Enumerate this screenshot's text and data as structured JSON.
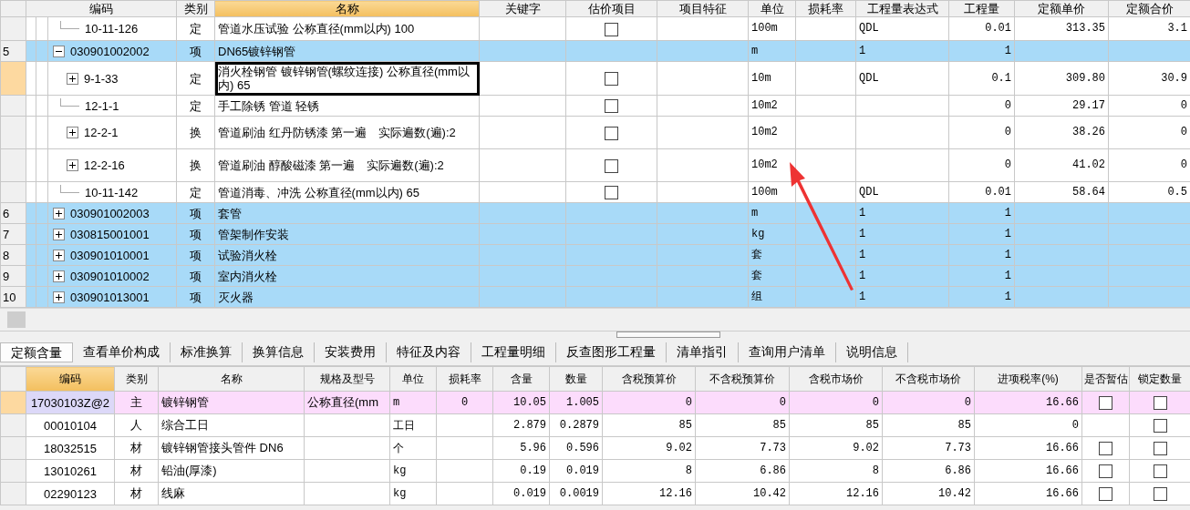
{
  "upper_table": {
    "columns": [
      {
        "label": "编码",
        "selected": false
      },
      {
        "label": "类别",
        "selected": false
      },
      {
        "label": "名称",
        "selected": true
      },
      {
        "label": "关键字",
        "selected": false
      },
      {
        "label": "估价项目",
        "selected": false
      },
      {
        "label": "项目特征",
        "selected": false
      },
      {
        "label": "单位",
        "selected": false
      },
      {
        "label": "损耗率",
        "selected": false
      },
      {
        "label": "工程量表达式",
        "selected": false
      },
      {
        "label": "工程量",
        "selected": false
      },
      {
        "label": "定额单价",
        "selected": false
      },
      {
        "label": "定额合价",
        "selected": false
      }
    ],
    "rows": [
      {
        "kind": "quota",
        "selected": false,
        "code": "10-11-126",
        "type": "定",
        "name": "管道水压试验 公称直径(mm以内) 100",
        "estimate": false,
        "unit": "100m",
        "expression": "QDL",
        "quantity": "0.01",
        "unit_price": "313.35",
        "total_price": "3.1"
      },
      {
        "kind": "item",
        "selected": false,
        "row_number": "5",
        "expanded": true,
        "code": "030901002002",
        "type": "项",
        "name": "DN65镀锌钢管",
        "unit": "m",
        "expression": "1",
        "quantity": "1",
        "children": [
          {
            "kind": "quota",
            "selected": true,
            "expanded": false,
            "code": "9-1-33",
            "type": "定",
            "name": "消火栓钢管 镀锌钢管(螺纹连接) 公称直径(mm以内) 65",
            "estimate": false,
            "unit": "10m",
            "expression": "QDL",
            "quantity": "0.1",
            "unit_price": "309.80",
            "total_price": "30.9"
          },
          {
            "kind": "quota",
            "selected": false,
            "code": "12-1-1",
            "type": "定",
            "name": "手工除锈 管道 轻锈",
            "estimate": false,
            "unit": "10m2",
            "quantity": "0",
            "unit_price": "29.17",
            "total_price": "0"
          },
          {
            "kind": "quota",
            "selected": false,
            "expanded": false,
            "code": "12-2-1",
            "type": "换",
            "name": "管道刷油 红丹防锈漆 第一遍　实际遍数(遍):2",
            "estimate": false,
            "unit": "10m2",
            "quantity": "0",
            "unit_price": "38.26",
            "total_price": "0"
          },
          {
            "kind": "quota",
            "selected": false,
            "expanded": false,
            "code": "12-2-16",
            "type": "换",
            "name": "管道刷油 醇酸磁漆 第一遍　实际遍数(遍):2",
            "estimate": false,
            "unit": "10m2",
            "quantity": "0",
            "unit_price": "41.02",
            "total_price": "0"
          },
          {
            "kind": "quota",
            "selected": false,
            "code": "10-11-142",
            "type": "定",
            "name": "管道消毒、冲洗 公称直径(mm以内) 65",
            "estimate": false,
            "unit": "100m",
            "expression": "QDL",
            "quantity": "0.01",
            "unit_price": "58.64",
            "total_price": "0.5"
          }
        ]
      },
      {
        "kind": "item",
        "selected": false,
        "row_number": "6",
        "expanded": false,
        "code": "030901002003",
        "type": "项",
        "name": "套管",
        "unit": "m",
        "expression": "1",
        "quantity": "1"
      },
      {
        "kind": "item",
        "selected": false,
        "row_number": "7",
        "expanded": false,
        "code": "030815001001",
        "type": "项",
        "name": "管架制作安装",
        "unit": "kg",
        "expression": "1",
        "quantity": "1"
      },
      {
        "kind": "item",
        "selected": false,
        "row_number": "8",
        "expanded": false,
        "code": "030901010001",
        "type": "项",
        "name": "试验消火栓",
        "unit": "套",
        "expression": "1",
        "quantity": "1"
      },
      {
        "kind": "item",
        "selected": false,
        "row_number": "9",
        "expanded": false,
        "code": "030901010002",
        "type": "项",
        "name": "室内消火栓",
        "unit": "套",
        "expression": "1",
        "quantity": "1"
      },
      {
        "kind": "item",
        "selected": false,
        "row_number": "10",
        "expanded": false,
        "code": "030901013001",
        "type": "项",
        "name": "灭火器",
        "unit": "组",
        "expression": "1",
        "quantity": "1"
      }
    ]
  },
  "tabs": [
    {
      "label": "定额含量",
      "selected": true
    },
    {
      "label": "查看单价构成",
      "selected": false
    },
    {
      "label": "标准换算",
      "selected": false
    },
    {
      "label": "换算信息",
      "selected": false
    },
    {
      "label": "安装费用",
      "selected": false
    },
    {
      "label": "特征及内容",
      "selected": false
    },
    {
      "label": "工程量明细",
      "selected": false
    },
    {
      "label": "反查图形工程量",
      "selected": false
    },
    {
      "label": "清单指引",
      "selected": false
    },
    {
      "label": "查询用户清单",
      "selected": false
    },
    {
      "label": "说明信息",
      "selected": false
    }
  ],
  "lower_table": {
    "columns": [
      {
        "label": "编码",
        "selected": true
      },
      {
        "label": "类别",
        "selected": false
      },
      {
        "label": "名称",
        "selected": false
      },
      {
        "label": "规格及型号",
        "selected": false
      },
      {
        "label": "单位",
        "selected": false
      },
      {
        "label": "损耗率",
        "selected": false
      },
      {
        "label": "含量",
        "selected": false
      },
      {
        "label": "数量",
        "selected": false
      },
      {
        "label": "含税预算价",
        "selected": false
      },
      {
        "label": "不含税预算价",
        "selected": false
      },
      {
        "label": "含税市场价",
        "selected": false
      },
      {
        "label": "不含税市场价",
        "selected": false
      },
      {
        "label": "进项税率(%)",
        "selected": false
      },
      {
        "label": "是否暂估",
        "selected": false
      },
      {
        "label": "锁定数量",
        "selected": false
      }
    ],
    "rows": [
      {
        "kind": "main_material",
        "selected": true,
        "cells": [
          "17030103Z@2",
          "主",
          "镀锌钢管",
          "公称直径(mm",
          "m",
          "0",
          "10.05",
          "1.005",
          "0",
          "0",
          "0",
          "0",
          "16.66"
        ],
        "provisional": false,
        "locked": false
      },
      {
        "kind": "material",
        "selected": false,
        "cells": [
          "00010104",
          "人",
          "综合工日",
          "",
          "工日",
          "",
          "2.879",
          "0.2879",
          "85",
          "85",
          "85",
          "85",
          "0"
        ],
        "locked": false
      },
      {
        "kind": "material",
        "selected": false,
        "cells": [
          "18032515",
          "材",
          "镀锌钢管接头管件 DN6",
          "",
          "个",
          "",
          "5.96",
          "0.596",
          "9.02",
          "7.73",
          "9.02",
          "7.73",
          "16.66"
        ],
        "provisional": false,
        "locked": false
      },
      {
        "kind": "material",
        "selected": false,
        "cells": [
          "13010261",
          "材",
          "铅油(厚漆)",
          "",
          "kg",
          "",
          "0.19",
          "0.019",
          "8",
          "6.86",
          "8",
          "6.86",
          "16.66"
        ],
        "provisional": false,
        "locked": false
      },
      {
        "kind": "material",
        "selected": false,
        "cells": [
          "02290123",
          "材",
          "线麻",
          "",
          "kg",
          "",
          "0.019",
          "0.0019",
          "12.16",
          "10.42",
          "12.16",
          "10.42",
          "16.66"
        ],
        "provisional": false,
        "locked": false
      }
    ]
  }
}
